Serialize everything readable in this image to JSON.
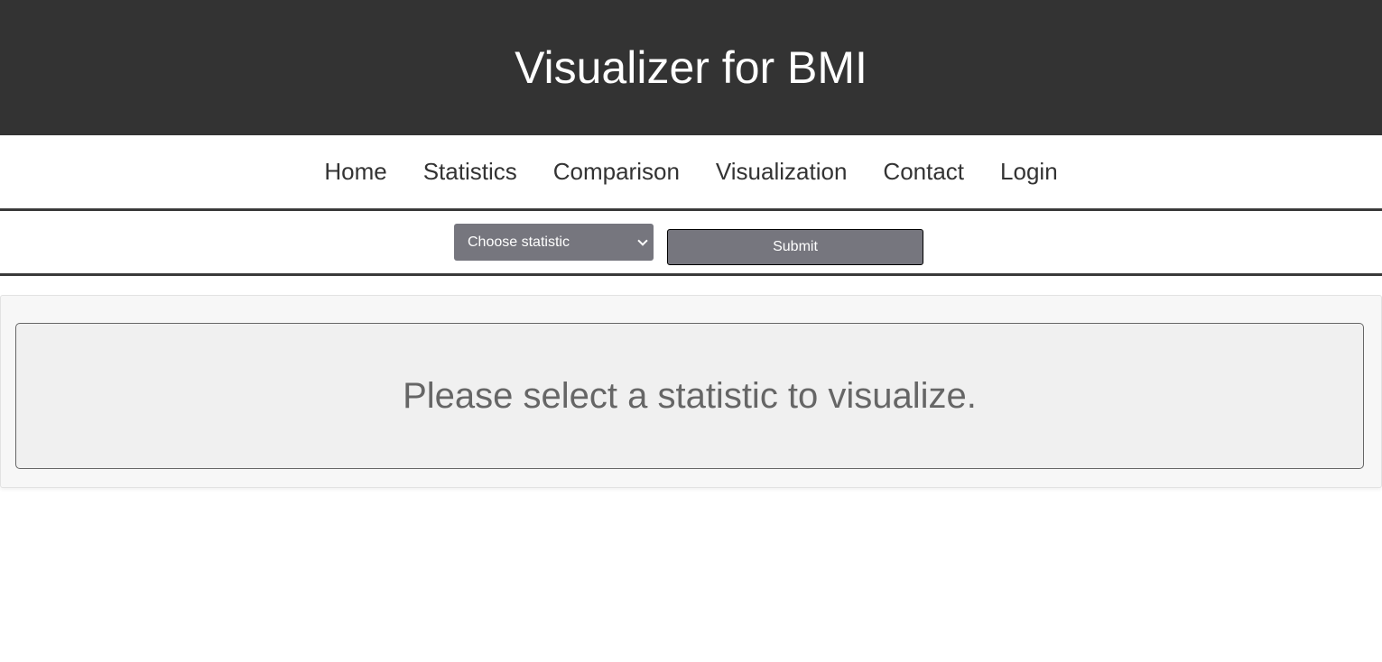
{
  "header": {
    "title": "Visualizer for BMI"
  },
  "nav": {
    "items": [
      {
        "label": "Home"
      },
      {
        "label": "Statistics"
      },
      {
        "label": "Comparison"
      },
      {
        "label": "Visualization"
      },
      {
        "label": "Contact"
      },
      {
        "label": "Login"
      }
    ]
  },
  "toolbar": {
    "select_value": "Choose statistic",
    "submit_label": "Submit"
  },
  "content": {
    "message": "Please select a statistic to visualize."
  },
  "colors": {
    "header_bg": "#333333",
    "control_bg": "#76767e",
    "message_text": "#666666"
  }
}
